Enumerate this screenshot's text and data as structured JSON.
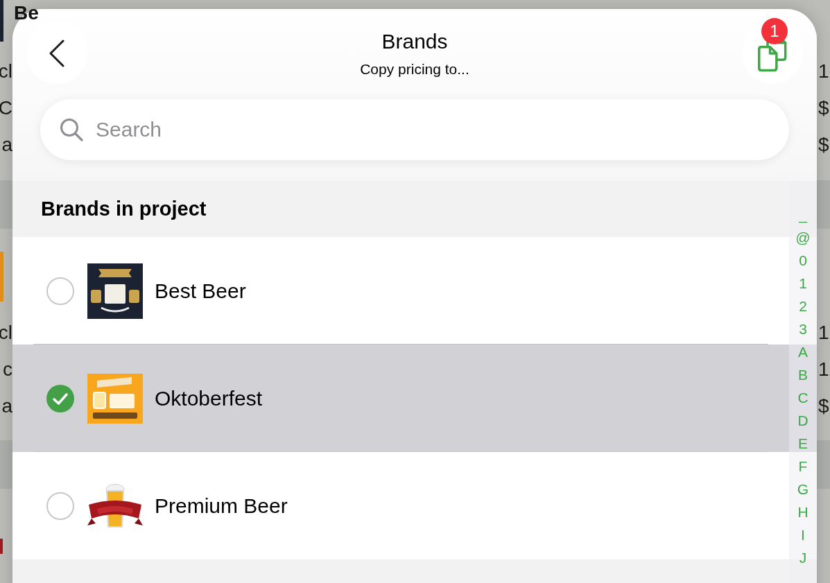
{
  "background_list": {
    "groups": [
      {
        "title": "Be",
        "rows": [
          {
            "column_1": "cl",
            "column_2": "1"
          },
          {
            "column_1": "C",
            "column_2": "$"
          },
          {
            "column_1": "a",
            "column_2": "$"
          }
        ]
      },
      {
        "rows": [
          {
            "column_1": "cl",
            "column_2": "1"
          },
          {
            "column_1": "c",
            "column_2": "1"
          },
          {
            "column_1": "a",
            "column_2": "$"
          }
        ]
      }
    ]
  },
  "sheet": {
    "title": "Brands",
    "subtitle": "Copy pricing to...",
    "copy_button": {
      "badge": "1"
    },
    "search": {
      "placeholder": "Search"
    },
    "section": {
      "title": "Brands in project",
      "items": [
        {
          "name": "Best Beer",
          "selected": false,
          "logo": {
            "kind": "emblem"
          }
        },
        {
          "name": "Oktoberfest",
          "selected": true,
          "logo": {
            "kind": "label"
          }
        },
        {
          "name": "Premium Beer",
          "selected": false,
          "logo": {
            "kind": "banner"
          }
        }
      ]
    },
    "index": [
      "_",
      "@",
      "0",
      "1",
      "2",
      "3",
      "A",
      "B",
      "C",
      "D",
      "E",
      "F",
      "G",
      "H",
      "I",
      "J"
    ]
  }
}
